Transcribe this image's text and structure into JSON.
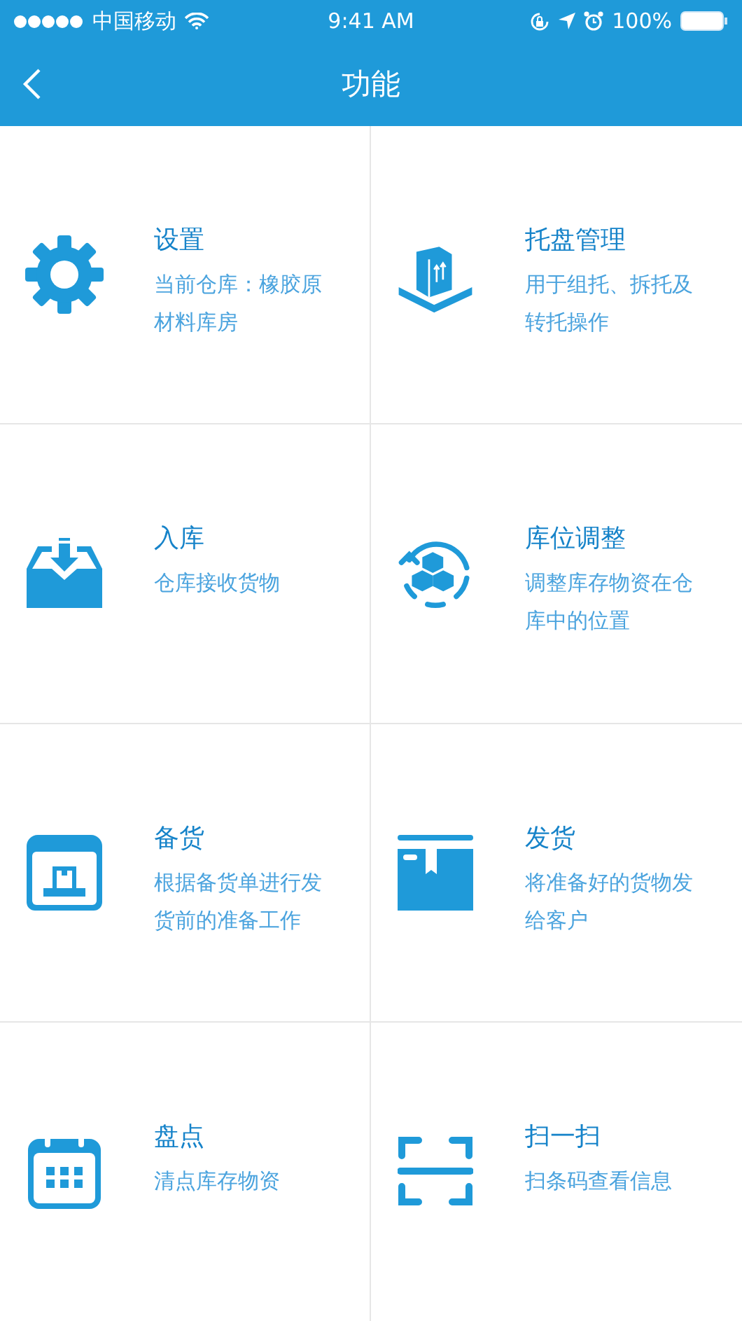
{
  "status_bar": {
    "carrier": "中国移动",
    "time": "9:41 AM",
    "battery": "100%"
  },
  "nav_bar": {
    "title": "功能"
  },
  "functions": [
    {
      "title": "设置",
      "description": "当前仓库：橡胶原材料库房"
    },
    {
      "title": "托盘管理",
      "description": "用于组托、拆托及转托操作"
    },
    {
      "title": "入库",
      "description": "仓库接收货物"
    },
    {
      "title": "库位调整",
      "description": "调整库存物资在仓库中的位置"
    },
    {
      "title": "备货",
      "description": "根据备货单进行发货前的准备工作"
    },
    {
      "title": "发货",
      "description": "将准备好的货物发给客户"
    },
    {
      "title": "盘点",
      "description": "清点库存物资"
    },
    {
      "title": "扫一扫",
      "description": "扫条码查看信息"
    }
  ]
}
